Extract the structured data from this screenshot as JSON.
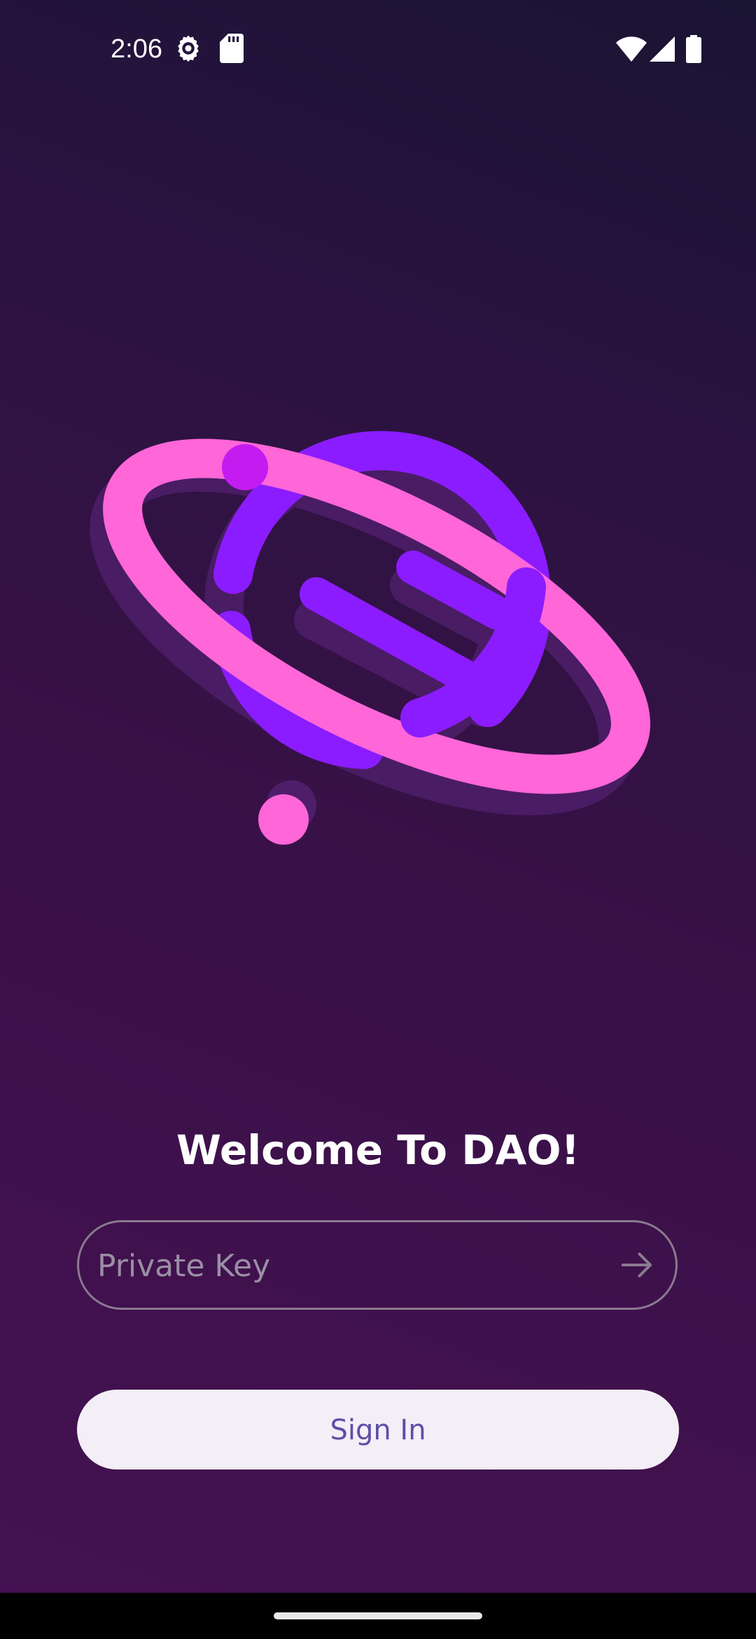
{
  "status_bar": {
    "time": "2:06",
    "icons": [
      "settings-icon",
      "sd-card-icon",
      "wifi-icon",
      "signal-icon",
      "battery-icon"
    ]
  },
  "illustration": {
    "name": "planet-logo",
    "colors": {
      "planet": "#8b1cff",
      "ring": "#ff66d8",
      "shadow": "#4e1e6a",
      "dot": "#c41cf0"
    }
  },
  "welcome": {
    "title": "Welcome To DAO!"
  },
  "private_key": {
    "placeholder": "Private Key",
    "value": "",
    "submit_icon": "arrow-right-icon"
  },
  "sign_in": {
    "label": "Sign In"
  },
  "theme": {
    "background_top": "#1a1433",
    "background_bottom": "#451152",
    "button_bg": "#f4eef7",
    "button_text": "#5c4fa8",
    "field_border": "#8a7a90"
  }
}
